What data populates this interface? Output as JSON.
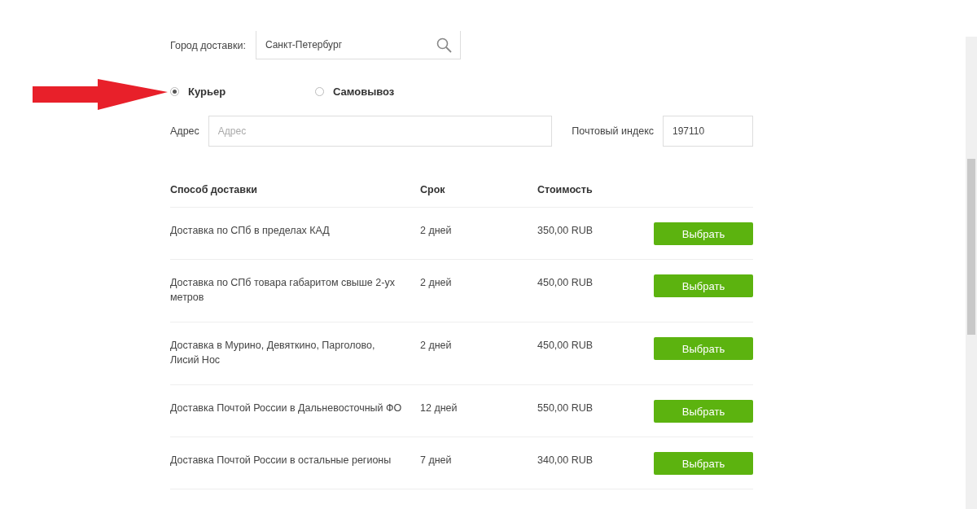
{
  "city": {
    "label": "Город доставки:",
    "value": "Санкт-Петербург"
  },
  "delivery_options": [
    {
      "label": "Курьер",
      "selected": true
    },
    {
      "label": "Самовывоз",
      "selected": false
    }
  ],
  "address": {
    "label": "Адрес",
    "placeholder": "Адрес"
  },
  "postcode": {
    "label": "Почтовый индекс",
    "value": "197110"
  },
  "table": {
    "columns": [
      "Способ доставки",
      "Срок",
      "Стоимость"
    ],
    "rows": [
      {
        "method": "Доставка по СПб в пределах КАД",
        "term": "2 дней",
        "cost": "350,00 RUB",
        "button": "Выбрать"
      },
      {
        "method": "Доставка по СПб товара габаритом свыше 2-ух метров",
        "term": "2 дней",
        "cost": "450,00 RUB",
        "button": "Выбрать"
      },
      {
        "method": "Доставка в Мурино, Девяткино, Парголово, Лисий Нос",
        "term": "2 дней",
        "cost": "450,00 RUB",
        "button": "Выбрать"
      },
      {
        "method": "Доставка Почтой России в Дальневосточный ФО",
        "term": "12 дней",
        "cost": "550,00 RUB",
        "button": "Выбрать"
      },
      {
        "method": "Доставка Почтой России в остальные регионы",
        "term": "7 дней",
        "cost": "340,00 RUB",
        "button": "Выбрать"
      }
    ]
  }
}
